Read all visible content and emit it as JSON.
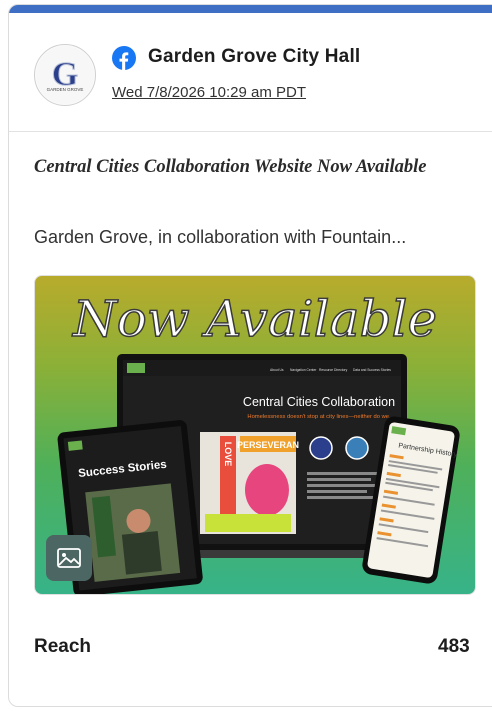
{
  "post": {
    "author": "Garden Grove City Hall",
    "logo_text": "GARDEN GROVE",
    "date": "Wed 7/8/2026 10:29 am PDT",
    "title": "Central Cities Collaboration Website Now Available",
    "excerpt": "Garden Grove, in collaboration with Fountain..."
  },
  "image": {
    "banner": "Now Available",
    "laptop_heading": "Central Cities Collaboration",
    "laptop_tagline": "Homelessness doesn't stop at city lines—neither do we.",
    "laptop_nav": [
      "About Us",
      "Navigation Center",
      "Resource Directory",
      "Data and Success Stories"
    ],
    "tablet_heading": "Success Stories",
    "phone_heading": "Partnership History",
    "art_text": "PERSEVERAN",
    "art_vertical": "LOVE"
  },
  "metrics": {
    "reach_label": "Reach",
    "reach_value": "483"
  },
  "colors": {
    "top_bar": "#3f6fc4",
    "facebook": "#1877f2",
    "tagline_orange": "#f07b2a",
    "image_gradient_top": "#b8ab2c",
    "image_gradient_bottom": "#37b389"
  },
  "icons": {
    "source": "facebook-icon",
    "image_badge": "image-icon"
  }
}
